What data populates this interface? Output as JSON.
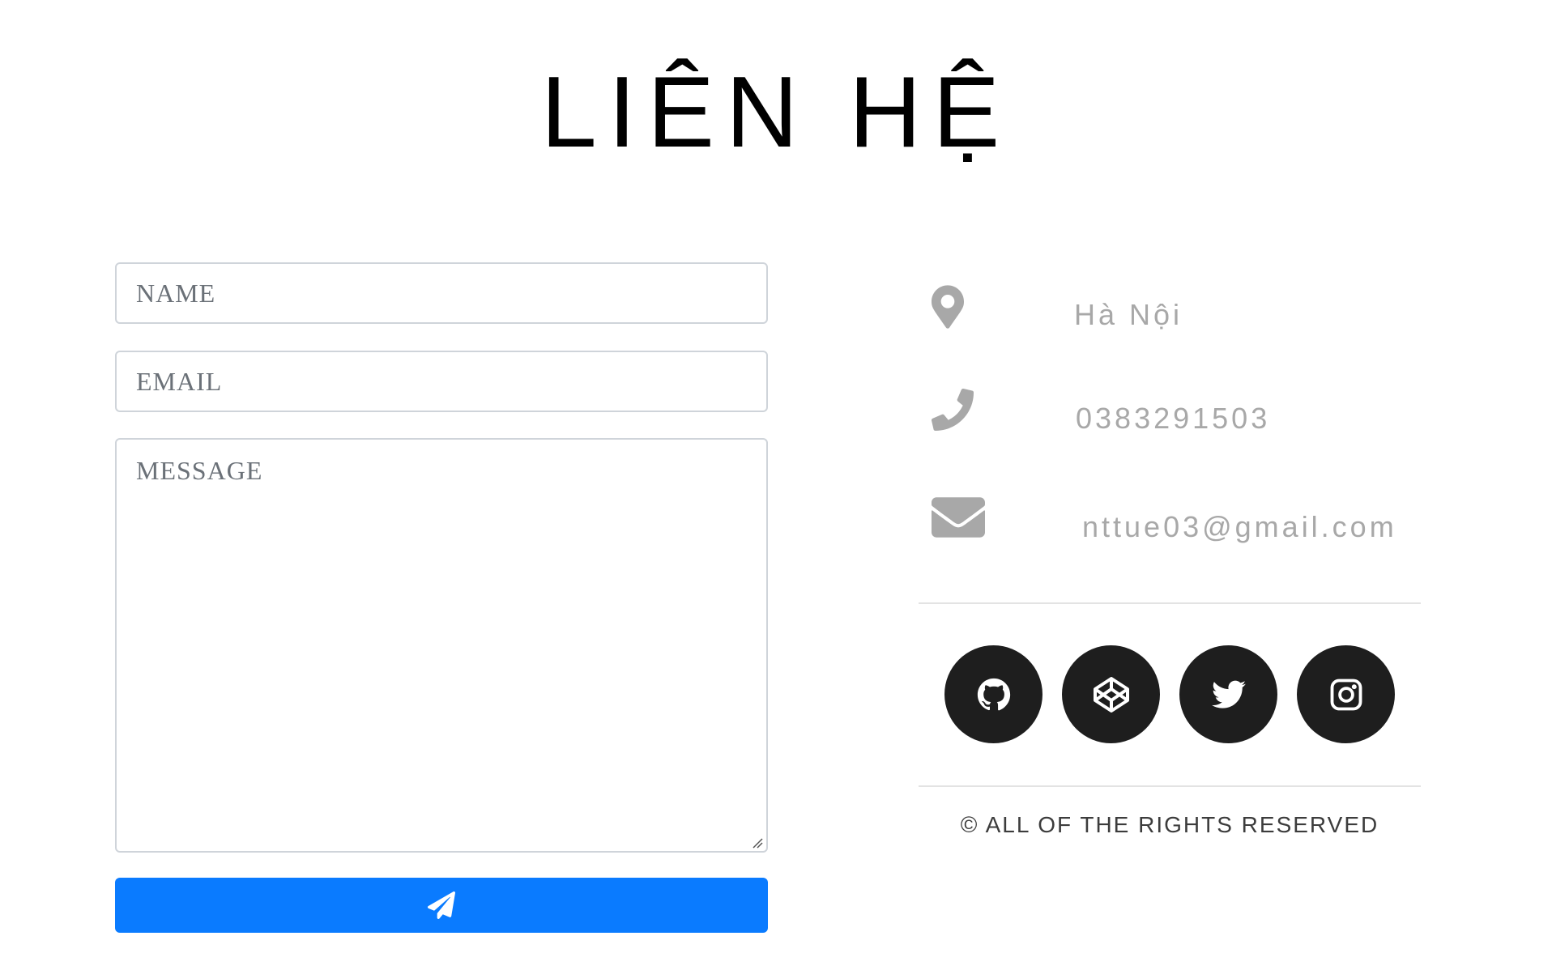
{
  "header": {
    "title": "LIÊN HỆ"
  },
  "form": {
    "name_placeholder": "NAME",
    "email_placeholder": "EMAIL",
    "message_placeholder": "MESSAGE",
    "send_icon": "paper-plane-icon",
    "button_color": "#0a7bff"
  },
  "contact": {
    "items": [
      {
        "icon": "map-marker-icon",
        "text": "Hà Nội"
      },
      {
        "icon": "phone-icon",
        "text": "0383291503"
      },
      {
        "icon": "envelope-icon",
        "text": "nttue03@gmail.com"
      }
    ]
  },
  "social": {
    "links": [
      {
        "icon": "github-icon"
      },
      {
        "icon": "codepen-icon"
      },
      {
        "icon": "twitter-icon"
      },
      {
        "icon": "instagram-icon"
      }
    ],
    "circle_color": "#1e1e1e"
  },
  "footer": {
    "copyright": "© ALL OF THE RIGHTS RESERVED"
  }
}
